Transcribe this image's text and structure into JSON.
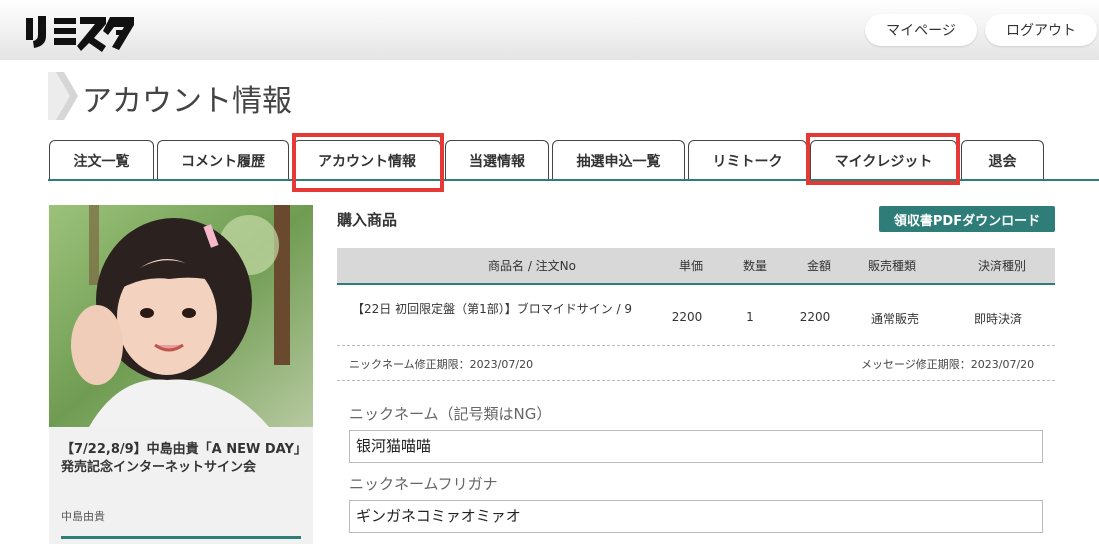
{
  "header": {
    "logo_text": "リミスタ",
    "mypage_label": "マイページ",
    "logout_label": "ログアウト"
  },
  "page": {
    "title": "アカウント情報"
  },
  "tabs": [
    {
      "label": "注文一覧"
    },
    {
      "label": "コメント履歴"
    },
    {
      "label": "アカウント情報",
      "highlighted": true
    },
    {
      "label": "当選情報"
    },
    {
      "label": "抽選申込一覧"
    },
    {
      "label": "リミトーク"
    },
    {
      "label": "マイクレジット",
      "highlighted": true
    },
    {
      "label": "退会"
    }
  ],
  "event_card": {
    "title": "【7/22,8/9】中島由貴「A NEW DAY」発売記念インターネットサイン会",
    "artist": "中島由貴"
  },
  "purchase": {
    "section_title": "購入商品",
    "pdf_button_label": "領収書PDFダウンロード",
    "columns": [
      "商品名 / 注文No",
      "単価",
      "数量",
      "金額",
      "販売種類",
      "決済種別"
    ],
    "rows": [
      [
        "【22日 初回限定盤（第1部）】ブロマイドサイン / 9",
        "2200",
        "1",
        "2200",
        "通常販売",
        "即時決済"
      ]
    ],
    "nickname_deadline": "ニックネーム修正期限：2023/07/20",
    "message_deadline": "メッセージ修正期限：2023/07/20"
  },
  "form": {
    "nickname_label": "ニックネーム（記号類はNG）",
    "nickname_value": "银河猫喵喵",
    "furigana_label": "ニックネームフリガナ",
    "furigana_value": "ギンガネコミァオミァオ"
  },
  "colors": {
    "accent": "#2e7d78",
    "highlight": "#e53935"
  }
}
